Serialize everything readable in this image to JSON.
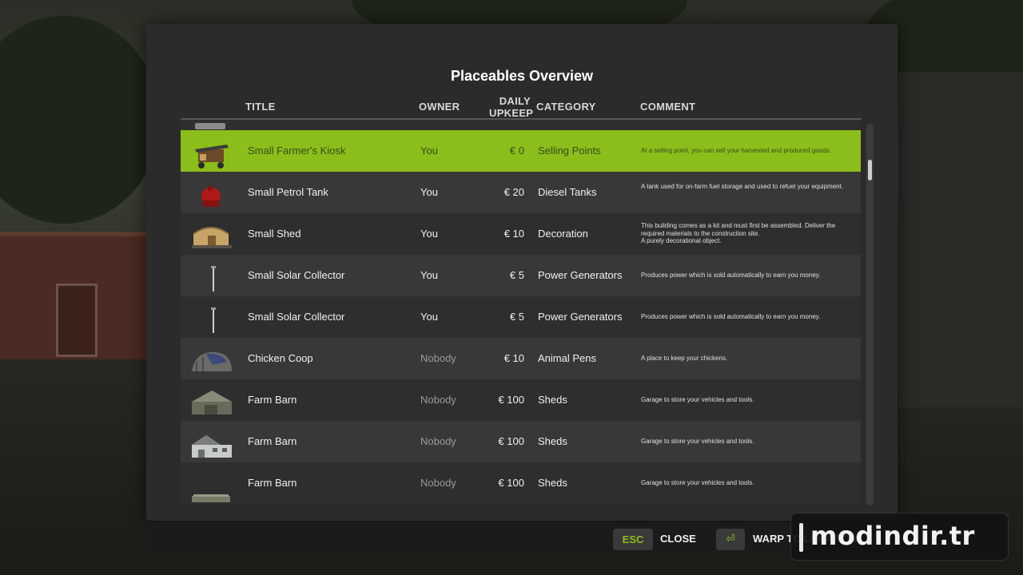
{
  "panel": {
    "title": "Placeables Overview"
  },
  "columns": {
    "title": "TITLE",
    "owner": "OWNER",
    "daily_upkeep_line1": "DAILY",
    "daily_upkeep_line2": "UPKEEP",
    "category": "CATEGORY",
    "comment": "COMMENT"
  },
  "rows": [
    {
      "title": "Small Farmer's Kiosk",
      "owner": "You",
      "upkeep": "€ 0",
      "category": "Selling Points",
      "comment": "At a selling point, you can sell your harvested and produced goods.",
      "selected": true,
      "thumb": "kiosk-icon"
    },
    {
      "title": "Small Petrol Tank",
      "owner": "You",
      "upkeep": "€ 20",
      "category": "Diesel Tanks",
      "comment": "A tank used for on-farm fuel storage and used to refuel your equipment.",
      "selected": false,
      "thumb": "petrol-tank-icon"
    },
    {
      "title": "Small Shed",
      "owner": "You",
      "upkeep": "€ 10",
      "category": "Decoration",
      "comment": "This building comes as a kit and must first be assembled. Deliver the required materials to the construction site.\nA purely decorational object.",
      "selected": false,
      "thumb": "shed-icon"
    },
    {
      "title": "Small Solar Collector",
      "owner": "You",
      "upkeep": "€ 5",
      "category": "Power Generators",
      "comment": "Produces power which is sold automatically to earn you money.",
      "selected": false,
      "thumb": "solar-collector-icon"
    },
    {
      "title": "Small Solar Collector",
      "owner": "You",
      "upkeep": "€ 5",
      "category": "Power Generators",
      "comment": "Produces power which is sold automatically to earn you money.",
      "selected": false,
      "thumb": "solar-collector-icon"
    },
    {
      "title": "Chicken Coop",
      "owner": "Nobody",
      "upkeep": "€ 10",
      "category": "Animal Pens",
      "comment": "A place to keep your chickens.",
      "selected": false,
      "thumb": "chicken-coop-icon"
    },
    {
      "title": "Farm Barn",
      "owner": "Nobody",
      "upkeep": "€ 100",
      "category": "Sheds",
      "comment": "Garage to store your vehicles and tools.",
      "selected": false,
      "thumb": "barn-icon"
    },
    {
      "title": "Farm Barn",
      "owner": "Nobody",
      "upkeep": "€ 100",
      "category": "Sheds",
      "comment": "Garage to store your vehicles and tools.",
      "selected": false,
      "thumb": "barn-white-icon"
    },
    {
      "title": "Farm Barn",
      "owner": "Nobody",
      "upkeep": "€ 100",
      "category": "Sheds",
      "comment": "Garage to store your vehicles and tools.",
      "selected": false,
      "thumb": "barn-icon"
    }
  ],
  "bottom": {
    "esc_key": "ESC",
    "close_label": "CLOSE",
    "enter_key": "⏎",
    "warp_label": "WARP TO LOCATION"
  },
  "watermark": {
    "text": "modindir.tr"
  },
  "colors": {
    "accent": "#8bbe1b",
    "panel": "#2b2b2b",
    "row_even": "#383838",
    "row_odd": "#2e2e2e"
  }
}
